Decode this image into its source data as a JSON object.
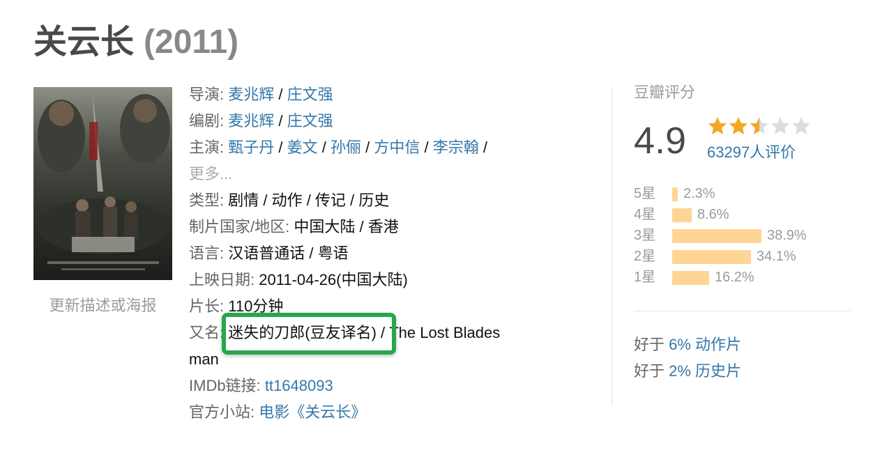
{
  "title": {
    "name": "关云长",
    "year": "(2011)"
  },
  "poster": {
    "update_link": "更新描述或海报"
  },
  "info": {
    "director_label": "导演:",
    "directors": [
      "麦兆辉",
      "庄文强"
    ],
    "writer_label": "编剧:",
    "writers": [
      "麦兆辉",
      "庄文强"
    ],
    "cast_label": "主演:",
    "cast": [
      "甄子丹",
      "姜文",
      "孙俪",
      "方中信",
      "李宗翰"
    ],
    "cast_more": "更多...",
    "genre_label": "类型:",
    "genres": "剧情 / 动作 / 传记 / 历史",
    "country_label": "制片国家/地区:",
    "country": "中国大陆 / 香港",
    "language_label": "语言:",
    "language": "汉语普通话 / 粤语",
    "release_label": "上映日期:",
    "release": "2011-04-26(中国大陆)",
    "runtime_label": "片长:",
    "runtime": "110分钟",
    "aka_label": "又名:",
    "aka_highlighted": "迷失的刀郎(豆友译名)",
    "aka_rest": " / The Lost Blades",
    "aka_wrap": "man",
    "imdb_label": "IMDb链接:",
    "imdb": "tt1648093",
    "site_label": "官方小站:",
    "site": "电影《关云长》",
    "separator": " / "
  },
  "rating": {
    "heading": "豆瓣评分",
    "score": "4.9",
    "stars_value": 2.5,
    "stars_max": 5,
    "votes": "63297人评价",
    "star_color": "#f6a623",
    "star_empty_color": "#dddddd",
    "bar_color": "#ffd596",
    "distribution": [
      {
        "label": "5星",
        "percent": 2.3,
        "text": "2.3%"
      },
      {
        "label": "4星",
        "percent": 8.6,
        "text": "8.6%"
      },
      {
        "label": "3星",
        "percent": 38.9,
        "text": "38.9%"
      },
      {
        "label": "2星",
        "percent": 34.1,
        "text": "34.1%"
      },
      {
        "label": "1星",
        "percent": 16.2,
        "text": "16.2%"
      }
    ]
  },
  "better_than": [
    {
      "prefix": "好于 ",
      "link": "6% 动作片"
    },
    {
      "prefix": "好于 ",
      "link": "2% 历史片"
    }
  ],
  "colors": {
    "link": "#3377aa",
    "highlight": "#24a84a"
  }
}
